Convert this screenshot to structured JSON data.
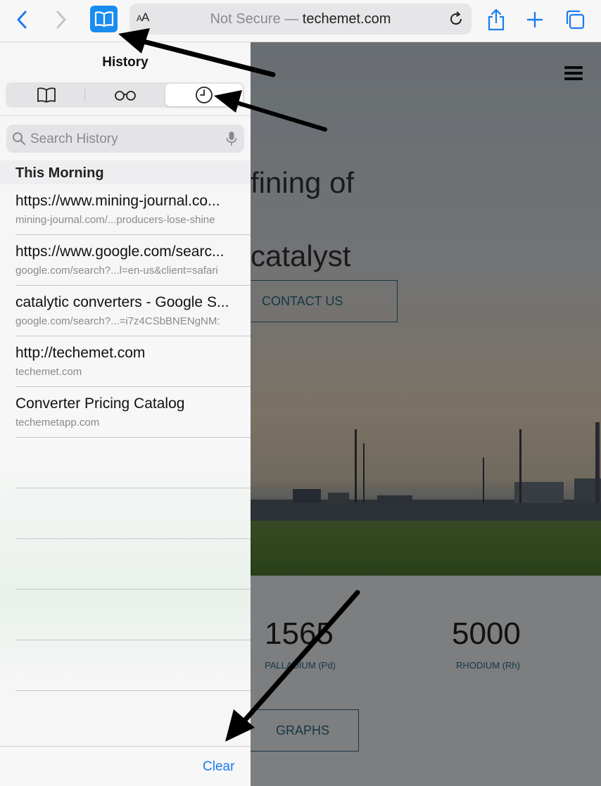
{
  "toolbar": {
    "url_prefix": "Not Secure —",
    "url_domain": "techemet.com",
    "text_size_label": "AA",
    "icons": [
      "back-icon",
      "forward-icon",
      "bookmarks-icon",
      "reload-icon",
      "share-icon",
      "plus-icon",
      "tabs-icon"
    ]
  },
  "sidebar": {
    "title": "History",
    "segments": [
      "bookmarks-icon",
      "reading-list-icon",
      "history-icon"
    ],
    "selected_segment": "history",
    "search_placeholder": "Search History",
    "section_header": "This Morning",
    "items": [
      {
        "title": "https://www.mining-journal.co...",
        "url": "mining-journal.com/...producers-lose-shine"
      },
      {
        "title": "https://www.google.com/searc...",
        "url": "google.com/search?...l=en-us&client=safari"
      },
      {
        "title": "catalytic converters - Google S...",
        "url": "google.com/search?...=i7z4CSbBNENgNM:"
      },
      {
        "title": "http://techemet.com",
        "url": "techemet.com"
      },
      {
        "title": "Converter Pricing Catalog",
        "url": "techemetapp.com"
      }
    ],
    "clear_label": "Clear"
  },
  "webpage": {
    "hero_line1": "fining of",
    "hero_line2": "catalyst",
    "contact_label": "CONTACT US",
    "stats": [
      {
        "value": "1565",
        "label": "PALLADIUM (Pd)"
      },
      {
        "value": "5000",
        "label": "RHODIUM (Rh)"
      }
    ],
    "graphs_label": "GRAPHS"
  },
  "colors": {
    "accent_blue": "#1a8cf0",
    "link_blue": "#1a7cf0",
    "site_teal": "#2c6a86"
  }
}
